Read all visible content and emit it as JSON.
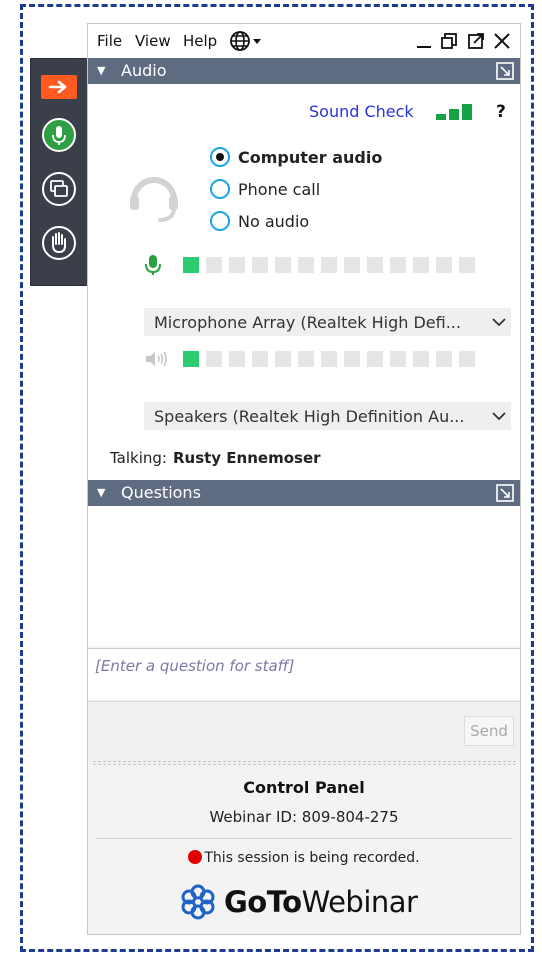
{
  "menu": {
    "file": "File",
    "view": "View",
    "help": "Help"
  },
  "icons": {
    "language": "globe-icon",
    "minimize": "minimize-icon",
    "restore": "restore-icon",
    "popout": "popout-icon",
    "close": "close-icon",
    "headset": "headset-icon",
    "microphone": "microphone-icon",
    "speaker": "speaker-icon",
    "raise_hand": "raise-hand-icon",
    "screen": "screen-icon",
    "collapse": "arrow-right-icon"
  },
  "colors": {
    "accent_orange": "#ff5a1f",
    "mic_green": "#2ea043",
    "level_green": "#2ecc71",
    "link_blue": "#2a32d8",
    "header_bar": "#5f6b80",
    "radio_border": "#1ba6e6",
    "record_red": "#e10000"
  },
  "audio": {
    "section_title": "Audio",
    "sound_check": "Sound Check",
    "help_mark": "?",
    "options": [
      {
        "label": "Computer audio",
        "selected": true
      },
      {
        "label": "Phone call",
        "selected": false
      },
      {
        "label": "No audio",
        "selected": false
      }
    ],
    "mic_level_segments": 13,
    "mic_level_active": 1,
    "speaker_level_segments": 13,
    "speaker_level_active": 1,
    "microphone_device": "Microphone Array (Realtek High Defi...",
    "speaker_device": "Speakers (Realtek High Definition Au...",
    "talking_label": "Talking:",
    "talking_name": "Rusty Ennemoser"
  },
  "questions": {
    "section_title": "Questions",
    "input_placeholder": "[Enter a question for staff]",
    "send_label": "Send"
  },
  "footer": {
    "title": "Control Panel",
    "webinar_id": "Webinar ID: 809-804-275",
    "recording_text": "This session is being recorded.",
    "brand_goto": "GoTo",
    "brand_webinar": "Webinar"
  }
}
